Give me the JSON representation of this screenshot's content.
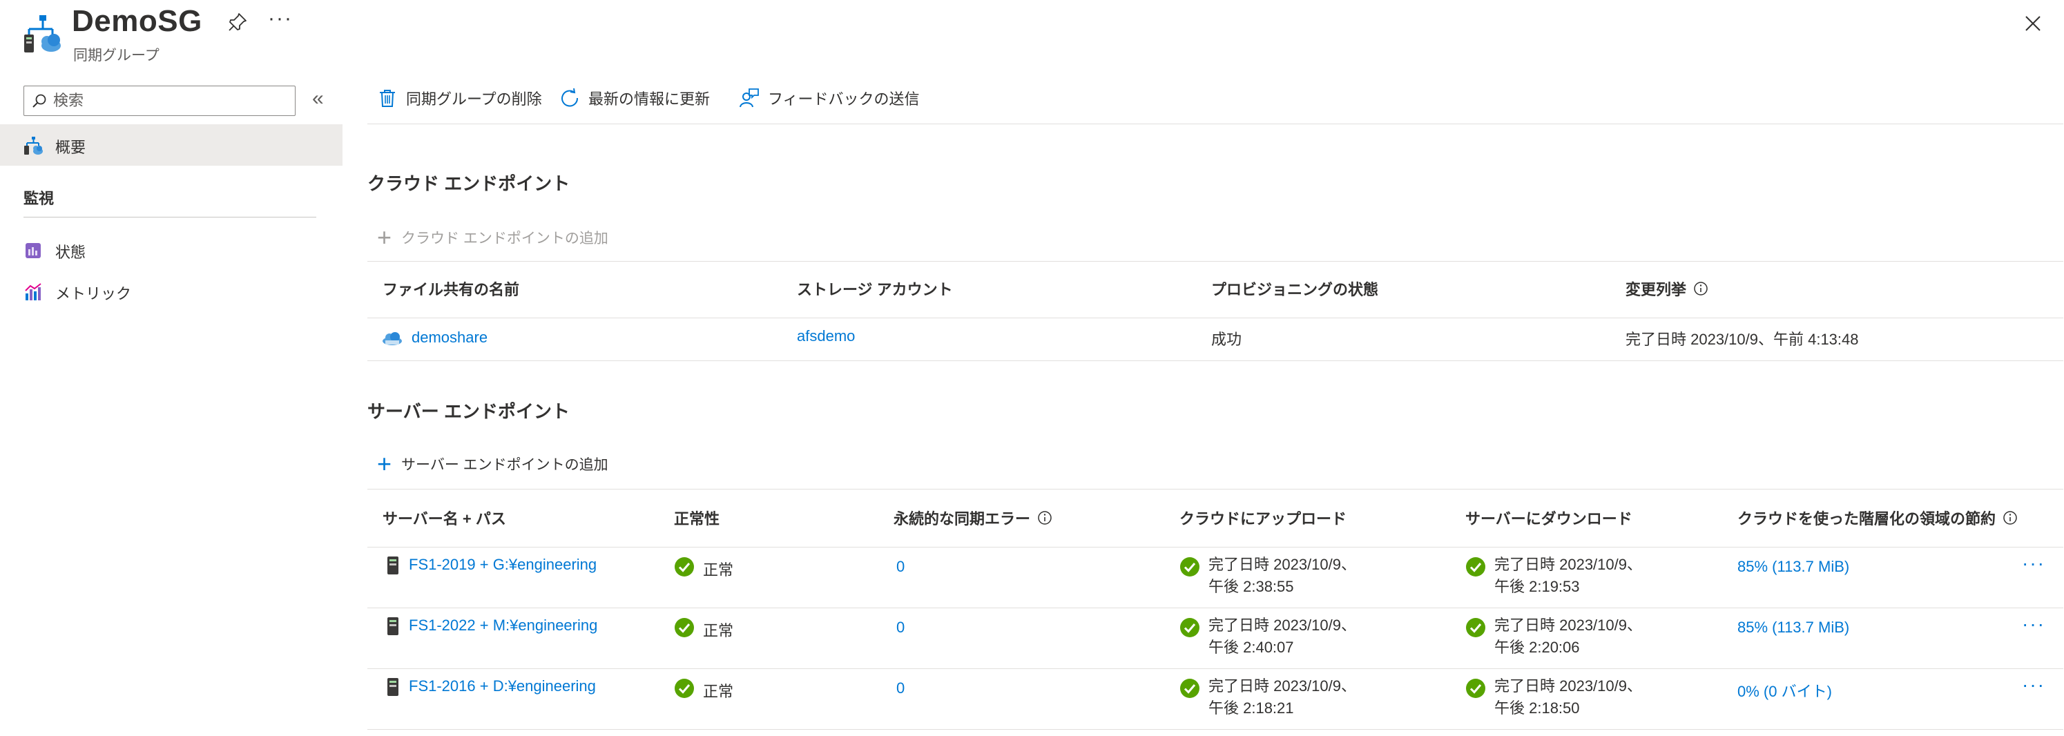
{
  "header": {
    "title": "DemoSG",
    "subtitle": "同期グループ"
  },
  "sidebar": {
    "search_placeholder": "検索",
    "items": [
      {
        "label": "概要",
        "selected": true
      }
    ],
    "groups": [
      {
        "label": "監視",
        "items": [
          {
            "label": "状態"
          },
          {
            "label": "メトリック"
          }
        ]
      }
    ]
  },
  "toolbar": {
    "delete_label": "同期グループの削除",
    "refresh_label": "最新の情報に更新",
    "feedback_label": "フィードバックの送信"
  },
  "cloud_endpoints": {
    "title": "クラウド エンドポイント",
    "add_label": "クラウド エンドポイントの追加",
    "columns": [
      "ファイル共有の名前",
      "ストレージ アカウント",
      "プロビジョニングの状態",
      "変更列挙"
    ],
    "rows": [
      {
        "share": "demoshare",
        "account": "afsdemo",
        "state": "成功",
        "enum": "完了日時 2023/10/9、午前 4:13:48"
      }
    ]
  },
  "server_endpoints": {
    "title": "サーバー エンドポイント",
    "add_label": "サーバー エンドポイントの追加",
    "columns": [
      "サーバー名 + パス",
      "正常性",
      "永続的な同期エラー",
      "クラウドにアップロード",
      "サーバーにダウンロード",
      "クラウドを使った階層化の領域の節約"
    ],
    "rows": [
      {
        "name": "FS1-2019 + G:¥engineering",
        "health": "正常",
        "errors": "0",
        "upload_1": "完了日時 2023/10/9、",
        "upload_2": "午後 2:38:55",
        "download_1": "完了日時 2023/10/9、",
        "download_2": "午後 2:19:53",
        "savings": "85% (113.7 MiB)"
      },
      {
        "name": "FS1-2022 + M:¥engineering",
        "health": "正常",
        "errors": "0",
        "upload_1": "完了日時 2023/10/9、",
        "upload_2": "午後 2:40:07",
        "download_1": "完了日時 2023/10/9、",
        "download_2": "午後 2:20:06",
        "savings": "85% (113.7 MiB)"
      },
      {
        "name": "FS1-2016 + D:¥engineering",
        "health": "正常",
        "errors": "0",
        "upload_1": "完了日時 2023/10/9、",
        "upload_2": "午後 2:18:21",
        "download_1": "完了日時 2023/10/9、",
        "download_2": "午後 2:18:50",
        "savings": "0% (0 バイト)"
      }
    ]
  },
  "colors": {
    "accent": "#0078d4",
    "success": "#57a300",
    "text": "#323130",
    "selected_bg": "#edebe9"
  }
}
